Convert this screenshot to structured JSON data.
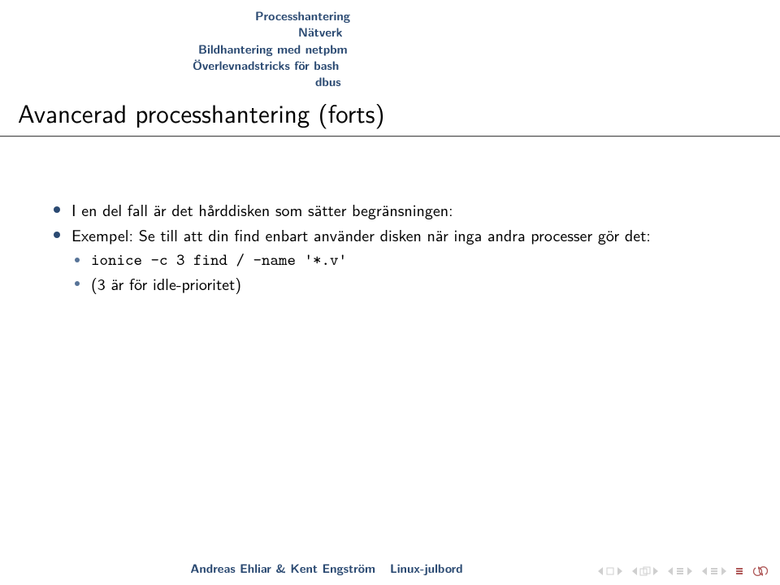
{
  "topics": {
    "t1": "Processhantering",
    "t2": "Nätverk",
    "t3": "Bildhantering med netpbm",
    "t4": "Överlevnadstricks för bash",
    "t5": "dbus"
  },
  "frame_title": "Avancerad processhantering (forts)",
  "bullets": {
    "b1": "I en del fall är det hårddisken som sätter begränsningen:",
    "b2": "Exempel: Se till att din find enbart använder disken när inga andra processer gör det:",
    "b2a": "ionice -c 3 find / -name '*.v'",
    "b2b": "(3 är för idle-prioritet)"
  },
  "footer": {
    "author": "Andreas Ehliar & Kent Engström",
    "lecture": "Linux-julbord"
  }
}
